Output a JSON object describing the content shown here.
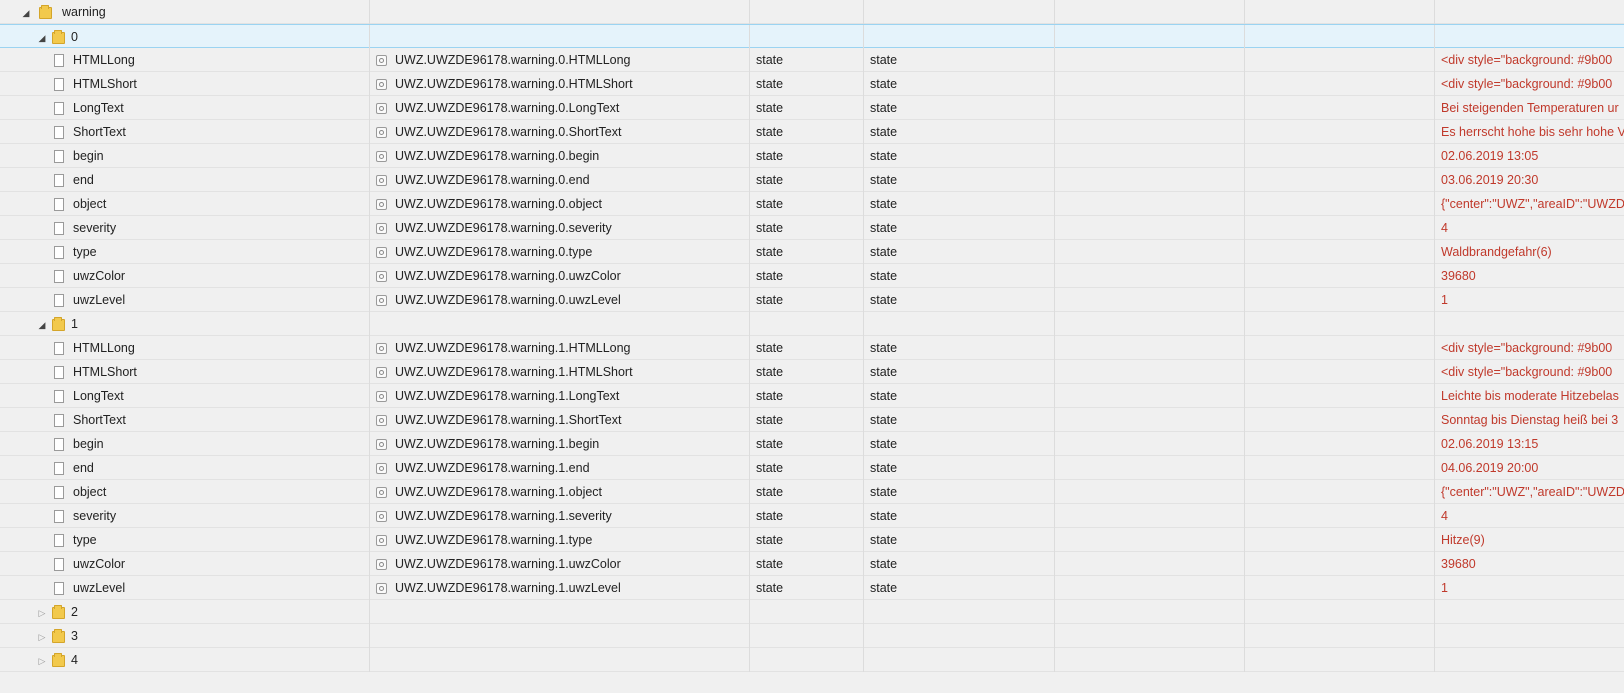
{
  "root": {
    "label": "warning"
  },
  "groups": [
    {
      "label": "0",
      "expanded": true,
      "children": [
        {
          "name": "HTMLLong",
          "id": "UWZ.UWZDE96178.warning.0.HTMLLong",
          "type": "state",
          "role": "state",
          "value": "<div style=\"background: #9b00"
        },
        {
          "name": "HTMLShort",
          "id": "UWZ.UWZDE96178.warning.0.HTMLShort",
          "type": "state",
          "role": "state",
          "value": "<div style=\"background: #9b00"
        },
        {
          "name": "LongText",
          "id": "UWZ.UWZDE96178.warning.0.LongText",
          "type": "state",
          "role": "state",
          "value": "Bei steigenden Temperaturen ur"
        },
        {
          "name": "ShortText",
          "id": "UWZ.UWZDE96178.warning.0.ShortText",
          "type": "state",
          "role": "state",
          "value": "Es herrscht hohe bis sehr hohe V"
        },
        {
          "name": "begin",
          "id": "UWZ.UWZDE96178.warning.0.begin",
          "type": "state",
          "role": "state",
          "value": "02.06.2019 13:05"
        },
        {
          "name": "end",
          "id": "UWZ.UWZDE96178.warning.0.end",
          "type": "state",
          "role": "state",
          "value": "03.06.2019 20:30"
        },
        {
          "name": "object",
          "id": "UWZ.UWZDE96178.warning.0.object",
          "type": "state",
          "role": "state",
          "value": "{\"center\":\"UWZ\",\"areaID\":\"UWZD"
        },
        {
          "name": "severity",
          "id": "UWZ.UWZDE96178.warning.0.severity",
          "type": "state",
          "role": "state",
          "value": "4"
        },
        {
          "name": "type",
          "id": "UWZ.UWZDE96178.warning.0.type",
          "type": "state",
          "role": "state",
          "value": "Waldbrandgefahr(6)"
        },
        {
          "name": "uwzColor",
          "id": "UWZ.UWZDE96178.warning.0.uwzColor",
          "type": "state",
          "role": "state",
          "value": "39680"
        },
        {
          "name": "uwzLevel",
          "id": "UWZ.UWZDE96178.warning.0.uwzLevel",
          "type": "state",
          "role": "state",
          "value": "1"
        }
      ]
    },
    {
      "label": "1",
      "expanded": true,
      "children": [
        {
          "name": "HTMLLong",
          "id": "UWZ.UWZDE96178.warning.1.HTMLLong",
          "type": "state",
          "role": "state",
          "value": "<div style=\"background: #9b00"
        },
        {
          "name": "HTMLShort",
          "id": "UWZ.UWZDE96178.warning.1.HTMLShort",
          "type": "state",
          "role": "state",
          "value": "<div style=\"background: #9b00"
        },
        {
          "name": "LongText",
          "id": "UWZ.UWZDE96178.warning.1.LongText",
          "type": "state",
          "role": "state",
          "value": "Leichte bis moderate Hitzebelas"
        },
        {
          "name": "ShortText",
          "id": "UWZ.UWZDE96178.warning.1.ShortText",
          "type": "state",
          "role": "state",
          "value": "Sonntag bis Dienstag heiß bei 3"
        },
        {
          "name": "begin",
          "id": "UWZ.UWZDE96178.warning.1.begin",
          "type": "state",
          "role": "state",
          "value": "02.06.2019 13:15"
        },
        {
          "name": "end",
          "id": "UWZ.UWZDE96178.warning.1.end",
          "type": "state",
          "role": "state",
          "value": "04.06.2019 20:00"
        },
        {
          "name": "object",
          "id": "UWZ.UWZDE96178.warning.1.object",
          "type": "state",
          "role": "state",
          "value": "{\"center\":\"UWZ\",\"areaID\":\"UWZD"
        },
        {
          "name": "severity",
          "id": "UWZ.UWZDE96178.warning.1.severity",
          "type": "state",
          "role": "state",
          "value": "4"
        },
        {
          "name": "type",
          "id": "UWZ.UWZDE96178.warning.1.type",
          "type": "state",
          "role": "state",
          "value": "Hitze(9)"
        },
        {
          "name": "uwzColor",
          "id": "UWZ.UWZDE96178.warning.1.uwzColor",
          "type": "state",
          "role": "state",
          "value": "39680"
        },
        {
          "name": "uwzLevel",
          "id": "UWZ.UWZDE96178.warning.1.uwzLevel",
          "type": "state",
          "role": "state",
          "value": "1"
        }
      ]
    },
    {
      "label": "2",
      "expanded": false,
      "children": []
    },
    {
      "label": "3",
      "expanded": false,
      "children": []
    },
    {
      "label": "4",
      "expanded": false,
      "children": []
    }
  ],
  "icons": {
    "expanded": "triangle-down-icon",
    "collapsed": "triangle-right-icon",
    "folder": "folder-icon",
    "file": "file-icon",
    "state": "state-icon"
  },
  "colors": {
    "value_text": "#c0392b",
    "selected_row": "#e5f3fb",
    "folder": "#f2c94c"
  }
}
